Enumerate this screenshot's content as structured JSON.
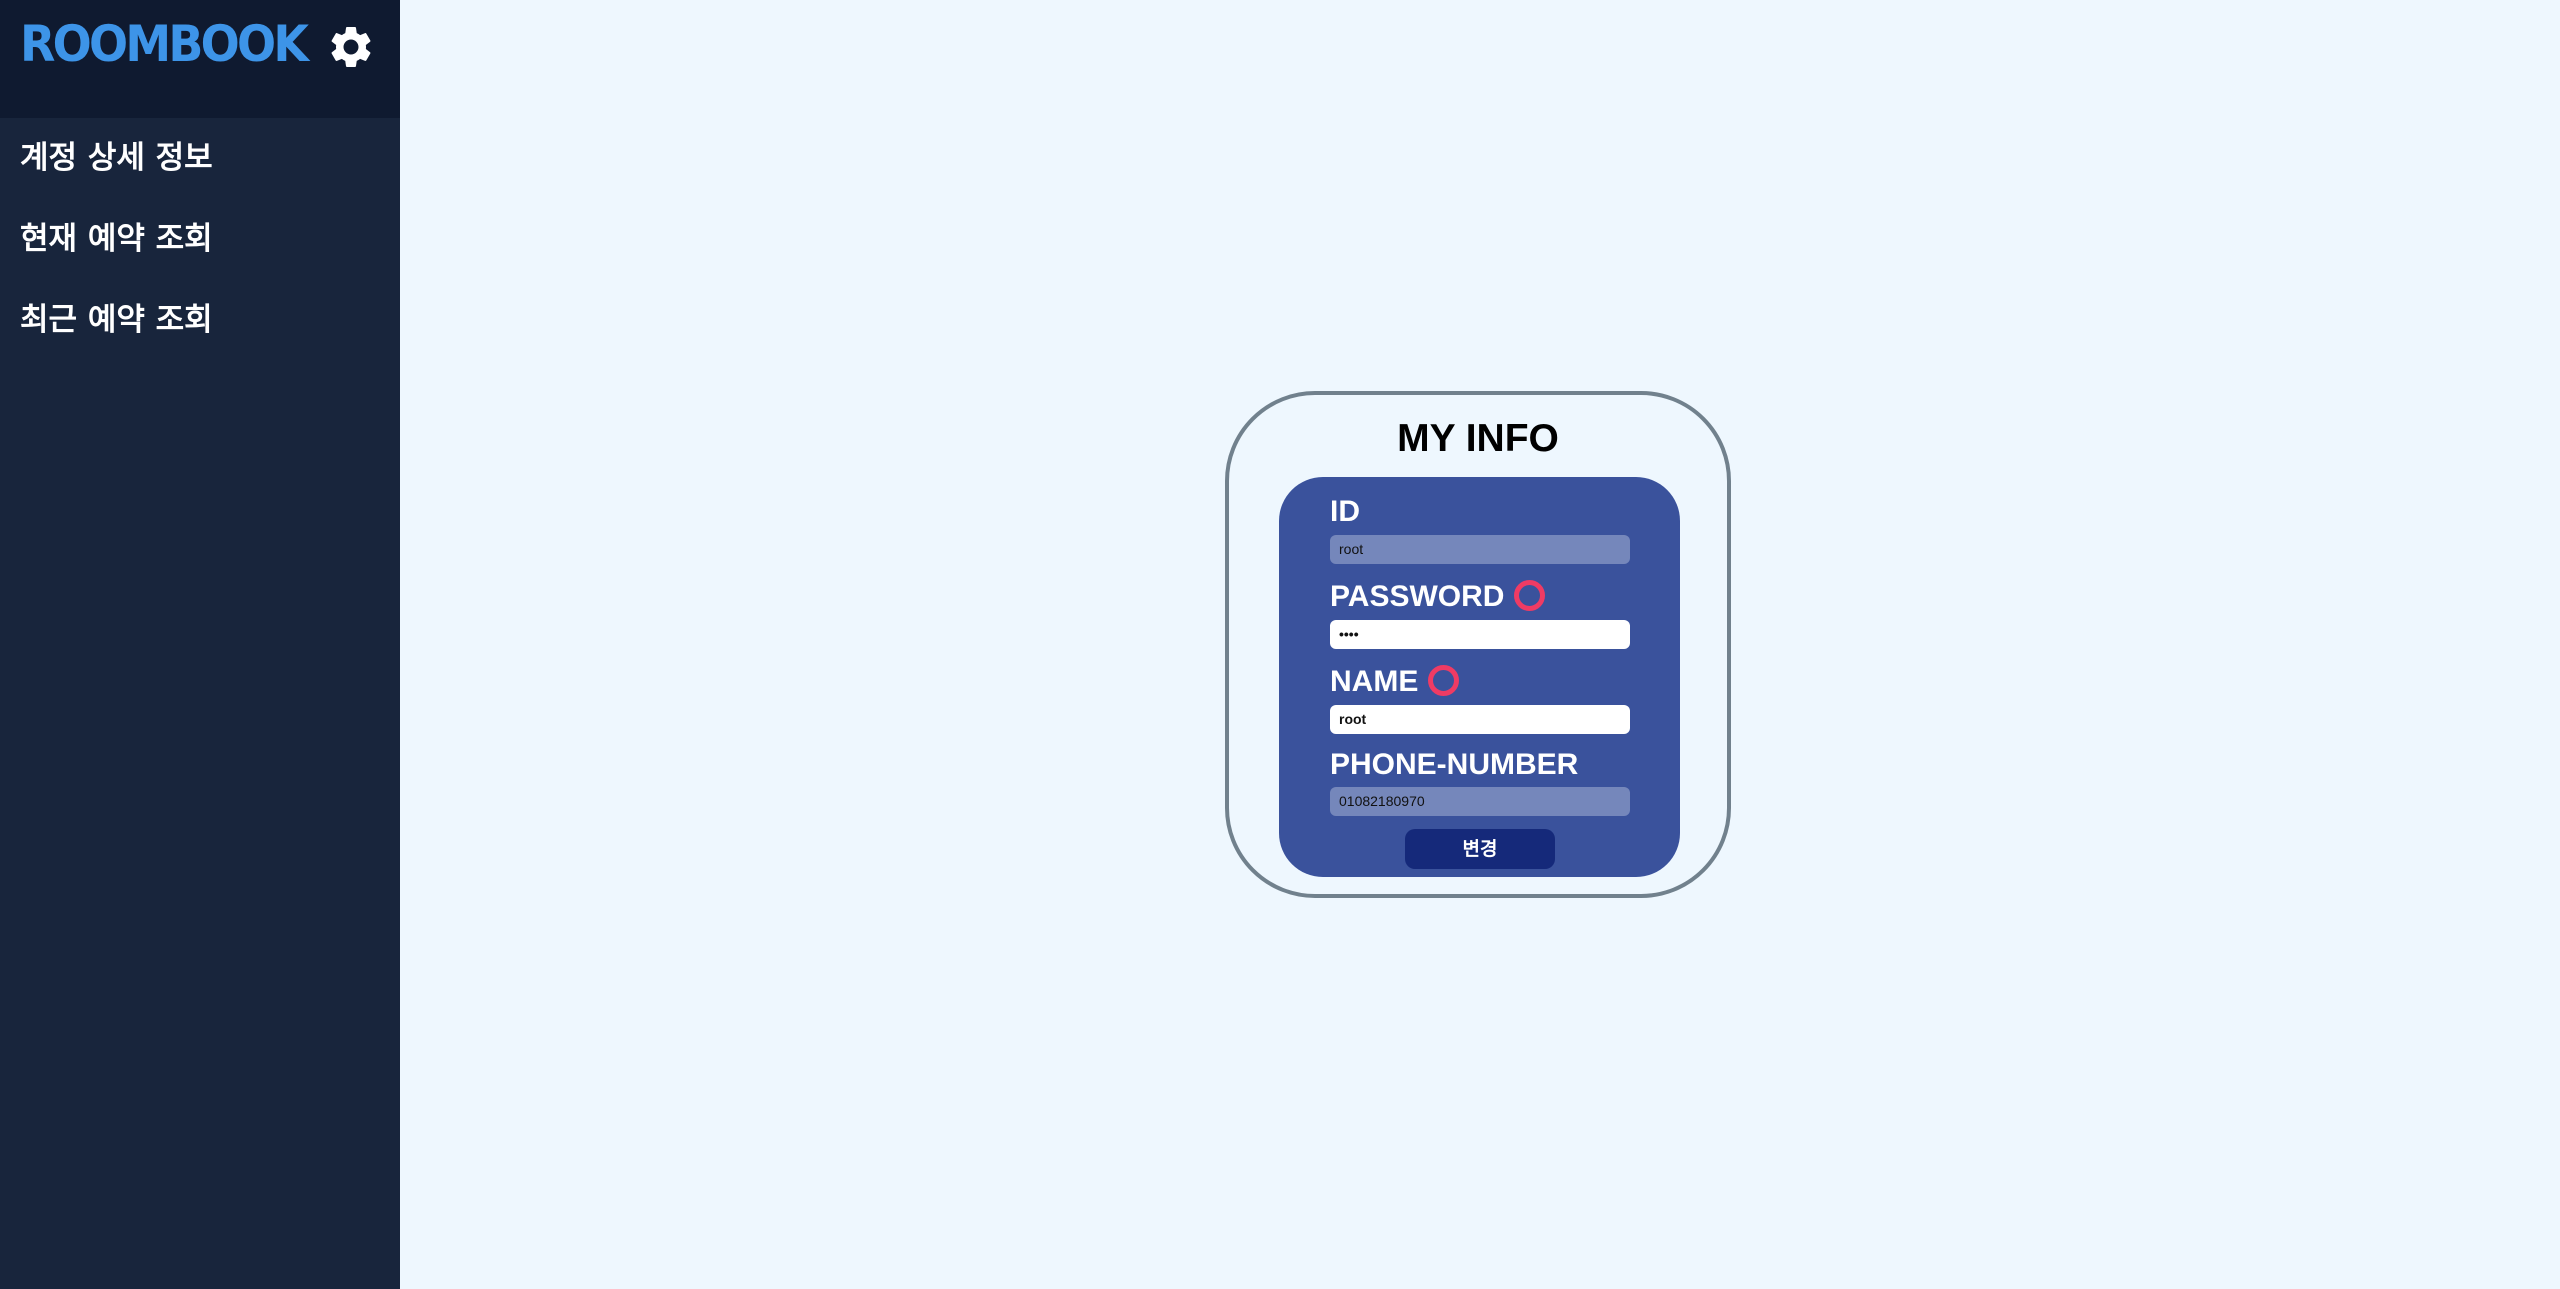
{
  "sidebar": {
    "logo": "ROOMBOOK",
    "settings_icon": "gear-icon",
    "items": [
      {
        "label": "계정 상세 정보"
      },
      {
        "label": "현재 예약 조회"
      },
      {
        "label": "최근 예약 조회"
      }
    ]
  },
  "card": {
    "title": "MY INFO",
    "fields": {
      "id": {
        "label": "ID",
        "value": "root",
        "editable": false
      },
      "password": {
        "label": "PASSWORD",
        "value": "••••",
        "editable": true,
        "indicator_icon": "ring-icon"
      },
      "name": {
        "label": "NAME",
        "value": "root",
        "editable": true,
        "indicator_icon": "ring-icon"
      },
      "phone": {
        "label": "PHONE-NUMBER",
        "value": "01082180970",
        "editable": false
      }
    },
    "submit_label": "변경"
  },
  "colors": {
    "page_background": "#eef7fe",
    "sidebar_background": "#18253c",
    "sidebar_header_background": "#0f1a30",
    "logo": "#3d94e8",
    "card_border": "#71818d",
    "form_background": "#3a529c",
    "readonly_input": "#7587bb",
    "ring_indicator": "#ef3b64",
    "submit_button": "#15297a"
  }
}
